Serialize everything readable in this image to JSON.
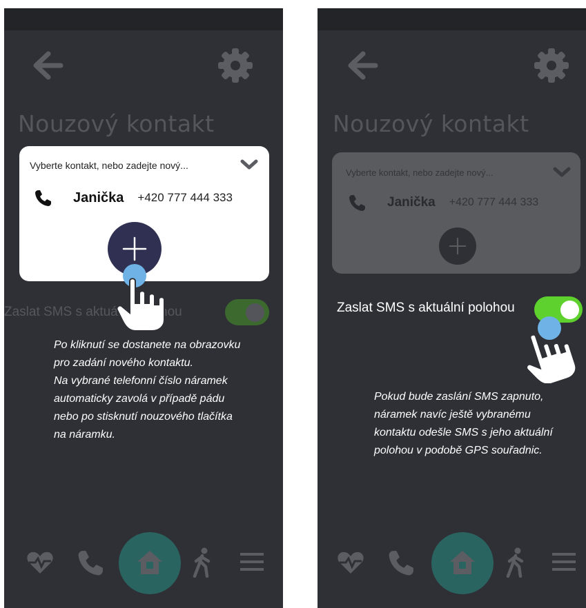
{
  "left": {
    "title": "Nouzový kontakt",
    "contact": {
      "hint": "Vyberte kontakt, nebo zadejte nový...",
      "name": "Janička",
      "number": "+420 777 444 333"
    },
    "sms_label": "Zaslat SMS s aktuální polohou",
    "sms_enabled": true,
    "explanation": [
      "Po kliknutí se dostanete na obrazovku",
      "pro zadání nového kontaktu.",
      "Na vybrané telefonní číslo náramek",
      "automaticky zavolá v případě pádu",
      "nebo po stisknutí nouzového tlačítka",
      "na náramku."
    ]
  },
  "right": {
    "title": "Nouzový kontakt",
    "contact": {
      "hint": "Vyberte kontakt, nebo zadejte nový...",
      "name": "Janička",
      "number": "+420 777 444 333"
    },
    "sms_label": "Zaslat SMS s aktuální polohou",
    "sms_enabled": true,
    "explanation": [
      "Pokud bude zaslání SMS zapnuto,",
      "náramek navíc ještě vybranému",
      "kontaktu odešle SMS s jeho aktuální",
      "polohou v podobě GPS souřadnic."
    ]
  },
  "icons": {
    "back": "arrow-left-icon",
    "settings": "gear-icon",
    "phone": "phone-icon",
    "expand": "chevron-down-icon",
    "add": "plus-icon",
    "nav": [
      "heartbeat-icon",
      "phone-icon",
      "home-icon",
      "walking-icon",
      "menu-icon"
    ]
  },
  "colors": {
    "background": "#2f3036",
    "toggle_on": "#5fd12f",
    "home_active": "#2a6460",
    "add_button": "#2f3052",
    "tap_indicator": "#6fb2e6"
  }
}
